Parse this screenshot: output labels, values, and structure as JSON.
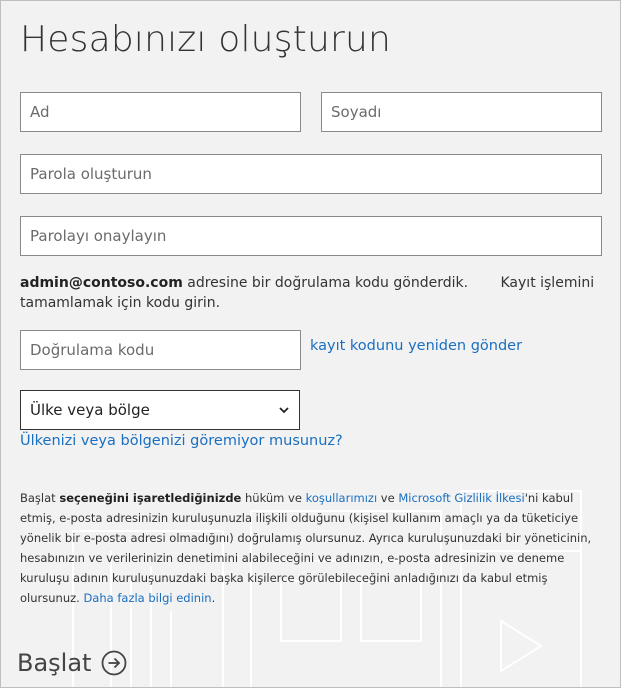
{
  "title": "Hesabınızı oluşturun",
  "fields": {
    "first_name_placeholder": "Ad",
    "last_name_placeholder": "Soyadı",
    "password_placeholder": "Parola oluşturun",
    "confirm_password_placeholder": "Parolayı onaylayın",
    "verification_placeholder": "Doğrulama kodu"
  },
  "info": {
    "email": "admin@contoso.com",
    "line1": " adresine bir doğrulama kodu gönderdik.",
    "line2": "Kayıt işlemini tamamlamak için kodu girin."
  },
  "resend_link": "kayıt kodunu yeniden gönder",
  "country": {
    "selected": "Ülke veya bölge",
    "missing_link": "Ülkenizi veya bölgenizi göremiyor musunuz?"
  },
  "legal": {
    "part1": "Başlat ",
    "bold": "seçeneğini işaretlediğinizde",
    "part2": " hüküm ve ",
    "terms_link": "koşullarımızı",
    "part3": " ve ",
    "privacy_link": "Microsoft Gizlilik İlkesi",
    "part4": "'ni kabul etmiş, e-posta adresinizin kuruluşunuzla ilişkili olduğunu (kişisel kullanım amaçlı ya da tüketiciye yönelik bir e-posta adresi olmadığını) doğrulamış olursunuz. Ayrıca kuruluşunuzdaki bir yöneticinin, hesabınızın ve verilerinizin denetimini alabileceğini ve adınızın, e-posta adresinizin ve deneme kuruluşu adının kuruluşunuzdaki başka kişilerce görülebileceğini anladığınızı da kabul etmiş olursunuz. ",
    "more_link": "Daha fazla bilgi edinin",
    "end": "."
  },
  "start_button": "Başlat",
  "icons": {
    "chevron": "chevron-down-icon",
    "arrow": "arrow-circle-right-icon"
  }
}
